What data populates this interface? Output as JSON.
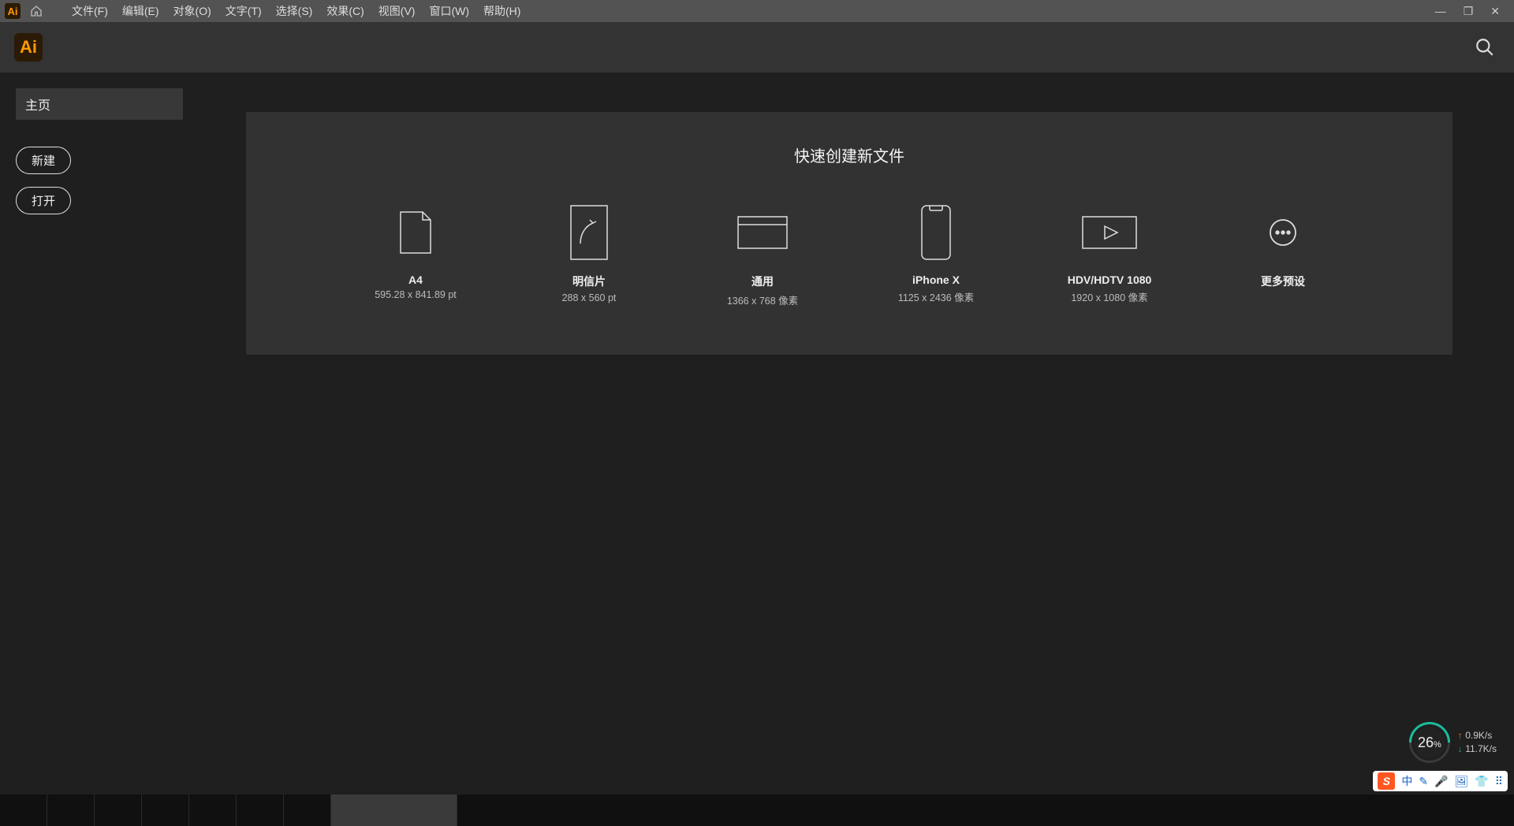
{
  "app": {
    "logo": "Ai"
  },
  "menubar": {
    "items": [
      "文件(F)",
      "编辑(E)",
      "对象(O)",
      "文字(T)",
      "选择(S)",
      "效果(C)",
      "视图(V)",
      "窗口(W)",
      "帮助(H)"
    ]
  },
  "window_controls": {
    "minimize": "—",
    "maximize": "❐",
    "close": "✕"
  },
  "sidebar": {
    "home_tab": "主页",
    "new_btn": "新建",
    "open_btn": "打开"
  },
  "quick": {
    "title": "快速创建新文件",
    "presets": [
      {
        "title": "A4",
        "sub": "595.28 x 841.89 pt"
      },
      {
        "title": "明信片",
        "sub": "288 x 560 pt"
      },
      {
        "title": "通用",
        "sub": "1366 x 768 像素"
      },
      {
        "title": "iPhone X",
        "sub": "1125 x 2436 像素"
      },
      {
        "title": "HDV/HDTV 1080",
        "sub": "1920 x 1080 像素"
      },
      {
        "title": "更多预设",
        "sub": ""
      }
    ]
  },
  "perf": {
    "percent": "26",
    "percent_suffix": "%",
    "up": "0.9K/s",
    "down": "11.7K/s"
  },
  "ime": {
    "lang": "中",
    "icons": [
      "✎",
      "🎤",
      "🖼",
      "👕",
      "⠿"
    ]
  }
}
